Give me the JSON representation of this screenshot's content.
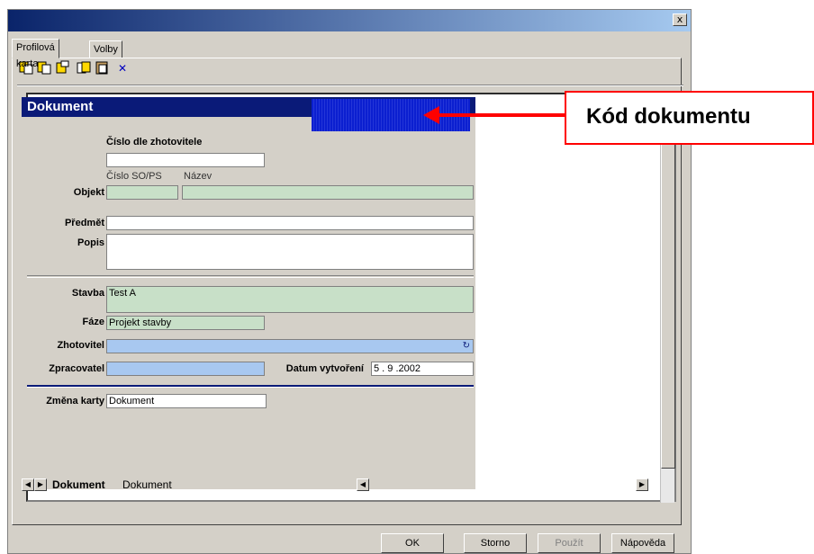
{
  "window": {
    "close_glyph": "x"
  },
  "tabs": [
    "Profilová karta",
    "Volby"
  ],
  "toolbar": {
    "delete_glyph": "✕"
  },
  "doc": {
    "title": "Dokument",
    "cislo_label": "Číslo dle zhotovitele",
    "cislo_value": "",
    "cislo_sops_label": "Číslo SO/PS",
    "nazev_label": "Název",
    "objekt_label": "Objekt",
    "predmet_label": "Předmět",
    "popis_label": "Popis",
    "stavba_label": "Stavba",
    "stavba_value": "Test A",
    "faze_label": "Fáze",
    "faze_value": "Projekt stavby",
    "zhotovitel_label": "Zhotovitel",
    "zpracovatel_label": "Zpracovatel",
    "datum_label": "Datum vytvoření",
    "datum_value": "5 . 9 .2002",
    "zmena_label": "Změna karty",
    "zmena_value": "Dokument"
  },
  "sheet_tabs": [
    "Dokument",
    "Dokument"
  ],
  "buttons": {
    "ok": "OK",
    "storno": "Storno",
    "pouzit": "Použít",
    "napoveda": "Nápověda"
  },
  "callout": "Kód dokumentu",
  "colors": {
    "callout_border": "#ff0000",
    "header": "#0a1a78",
    "code_box": "#0b1fd0"
  }
}
